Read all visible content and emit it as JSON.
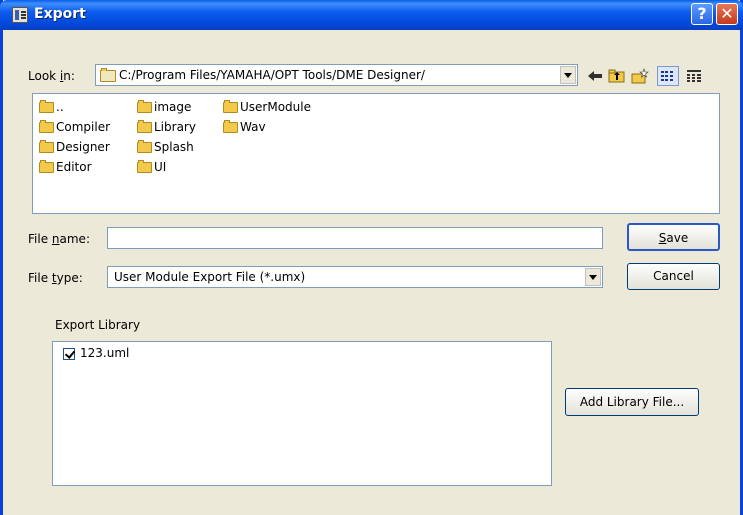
{
  "window": {
    "title": "Export",
    "help_glyph": "?",
    "close_glyph": "✕"
  },
  "look_in": {
    "label_pre": "Look ",
    "label_key": "i",
    "label_post": "n:",
    "path": "C:/Program Files/YAMAHA/OPT Tools/DME Designer/"
  },
  "toolbar": {
    "icons": [
      "back-arrow-icon",
      "up-folder-icon",
      "new-folder-icon",
      "list-view-icon",
      "details-view-icon"
    ]
  },
  "files": {
    "col1": [
      "..",
      "Compiler",
      "Designer",
      "Editor"
    ],
    "col2": [
      "image",
      "Library",
      "Splash",
      "UI"
    ],
    "col3": [
      "UserModule",
      "Wav"
    ]
  },
  "file_name": {
    "label_pre": "File ",
    "label_key": "n",
    "label_post": "ame:",
    "value": ""
  },
  "file_type": {
    "label_pre": "File ",
    "label_key": "t",
    "label_post": "ype:",
    "value": "User Module Export File (*.umx)"
  },
  "buttons": {
    "save_key": "S",
    "save_rest": "ave",
    "cancel": "Cancel",
    "add_library": "Add Library File..."
  },
  "export_library": {
    "heading": "Export Library",
    "items": [
      {
        "name": "123.uml",
        "checked": true
      }
    ]
  }
}
